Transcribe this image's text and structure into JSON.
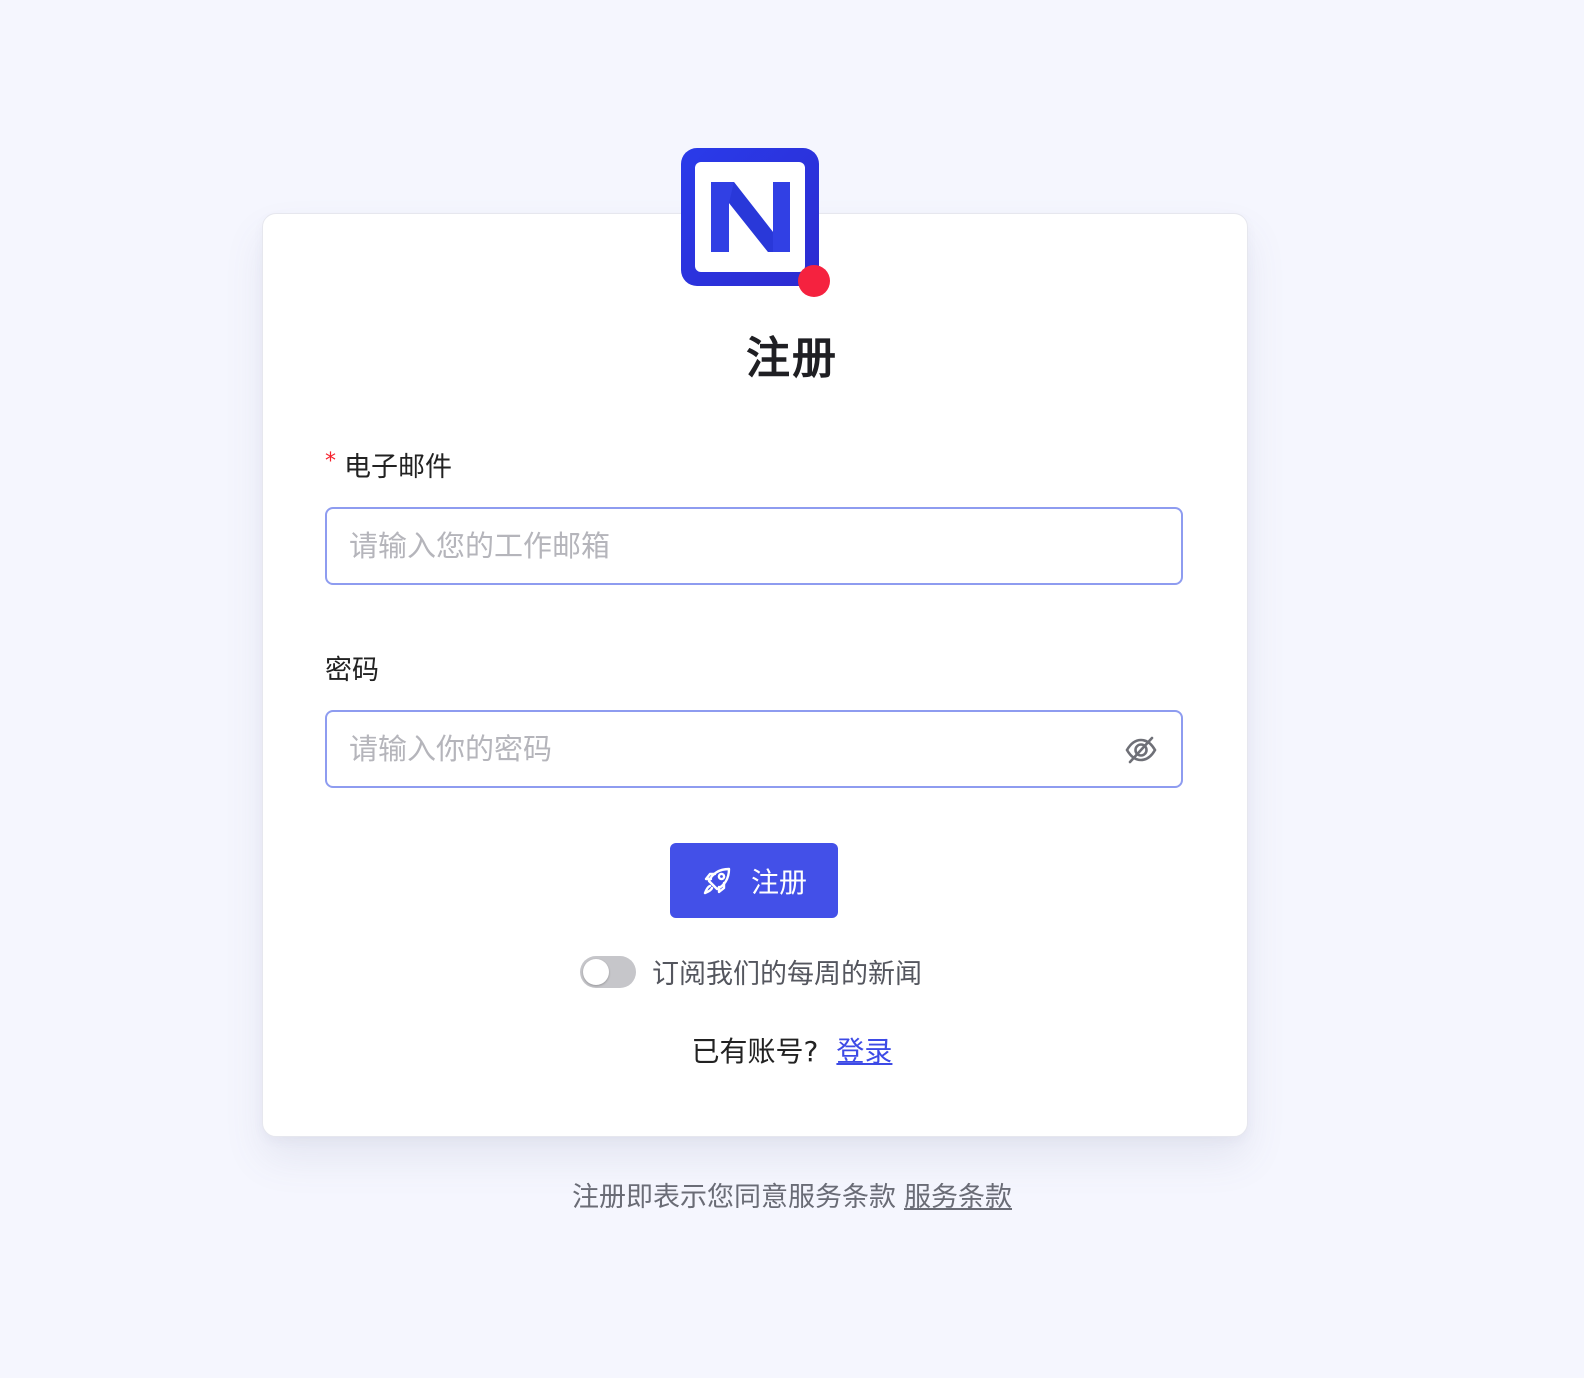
{
  "brand": {
    "logo_letter": "N",
    "primary_color": "#4350e8",
    "dot_color": "#f5223f"
  },
  "form": {
    "title": "注册",
    "email": {
      "required_mark": "*",
      "label": "电子邮件",
      "placeholder": "请输入您的工作邮箱",
      "value": ""
    },
    "password": {
      "label": "密码",
      "placeholder": "请输入你的密码",
      "value": "",
      "toggle_icon": "eye-off-icon"
    },
    "submit": {
      "icon": "rocket-icon",
      "label": "注册"
    },
    "newsletter": {
      "label": "订阅我们的每周的新闻",
      "checked": false
    },
    "login_prompt": {
      "text": "已有账号?",
      "link": "登录"
    }
  },
  "footer": {
    "text": "注册即表示您同意服务条款",
    "link": "服务条款"
  }
}
